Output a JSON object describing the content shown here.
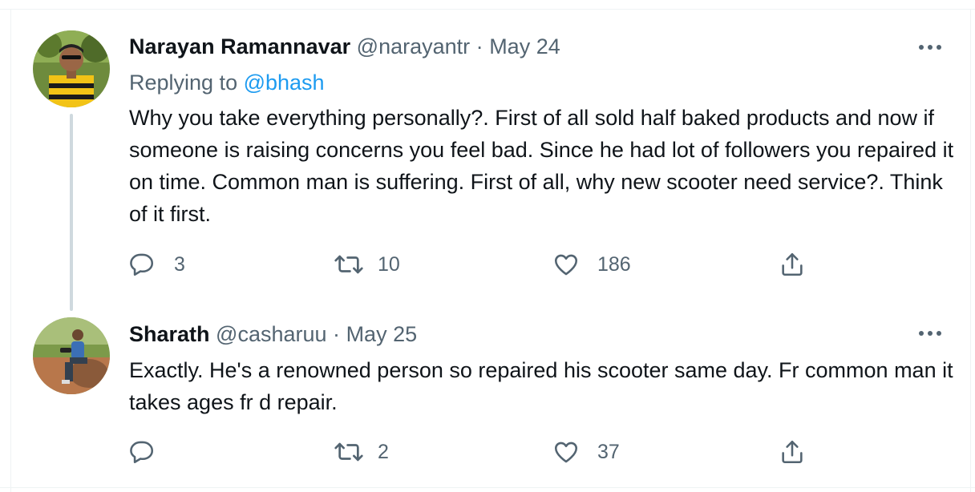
{
  "tweets": [
    {
      "author_name": "Narayan Ramannavar",
      "handle": "@narayantr",
      "separator": "·",
      "date": "May 24",
      "replying_prefix": "Replying to ",
      "replying_to": "@bhash",
      "text": "Why you take everything personally?. First of all sold half baked products and now if someone is raising concerns you feel bad. Since he had lot of followers you repaired it on time. Common man is suffering. First of all, why new scooter need service?. Think of it first.",
      "replies": "3",
      "retweets": "10",
      "likes": "186"
    },
    {
      "author_name": "Sharath",
      "handle": "@casharuu",
      "separator": "·",
      "date": "May 25",
      "text": "Exactly. He's a renowned person so repaired his scooter same day. Fr common man it takes ages fr d repair.",
      "replies": "",
      "retweets": "2",
      "likes": "37"
    }
  ],
  "icons": [
    "more-icon",
    "reply-icon",
    "retweet-icon",
    "like-icon",
    "share-icon"
  ],
  "colors": {
    "accent": "#1d9bf0",
    "secondary_text": "#536471",
    "primary_text": "#0f1419",
    "thread_line": "#cfd9de"
  }
}
